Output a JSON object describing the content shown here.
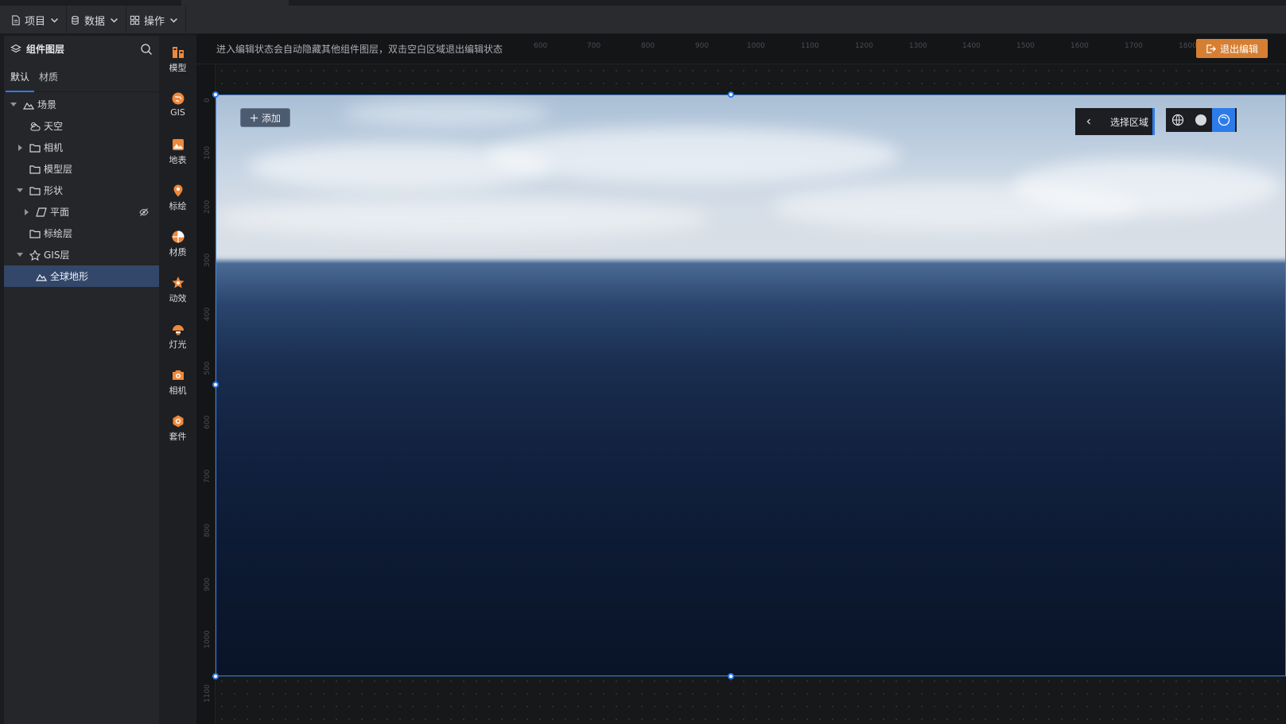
{
  "topbar": {
    "menus": [
      {
        "label": "项目",
        "icon": "file-icon"
      },
      {
        "label": "数据",
        "icon": "database-icon"
      },
      {
        "label": "操作",
        "icon": "grid-icon"
      }
    ]
  },
  "layers": {
    "title": "组件图层",
    "tabs": [
      "默认",
      "材质"
    ],
    "tree": [
      {
        "label": "场景",
        "icon": "mountain-icon"
      },
      {
        "label": "天空",
        "icon": "sky-icon"
      },
      {
        "label": "相机",
        "icon": "folder-icon"
      },
      {
        "label": "模型层",
        "icon": "folder-icon"
      },
      {
        "label": "形状",
        "icon": "folder-icon"
      },
      {
        "label": "平面",
        "icon": "plane-icon"
      },
      {
        "label": "标绘层",
        "icon": "folder-icon"
      },
      {
        "label": "GIS层",
        "icon": "gis-icon"
      },
      {
        "label": "全球地形",
        "icon": "terrain-icon"
      }
    ]
  },
  "rail": [
    {
      "label": "模型",
      "icon": "model-icon"
    },
    {
      "label": "GIS",
      "icon": "gis-globe-icon"
    },
    {
      "label": "地表",
      "icon": "surface-icon"
    },
    {
      "label": "标绘",
      "icon": "marker-icon"
    },
    {
      "label": "材质",
      "icon": "material-icon"
    },
    {
      "label": "动效",
      "icon": "effect-icon"
    },
    {
      "label": "灯光",
      "icon": "light-icon"
    },
    {
      "label": "相机",
      "icon": "camera-icon"
    },
    {
      "label": "套件",
      "icon": "kit-icon"
    }
  ],
  "canvas": {
    "hint": "进入编辑状态会自动隐藏其他组件图层，双击空白区域退出编辑状态",
    "exit_label": "退出编辑",
    "add_label": "添加",
    "region_label": "选择区域",
    "ruler_top": [
      "600",
      "700",
      "800",
      "900",
      "1000",
      "1100",
      "1200",
      "1300",
      "1400",
      "1500",
      "1600",
      "1700",
      "1800"
    ],
    "ruler_left": [
      "0",
      "100",
      "200",
      "300",
      "400",
      "500",
      "600",
      "700",
      "800",
      "900",
      "1000",
      "1100"
    ]
  },
  "colors": {
    "accent": "#2d7be8",
    "exit": "#d67f33",
    "icon_orange": "#f0883a"
  }
}
